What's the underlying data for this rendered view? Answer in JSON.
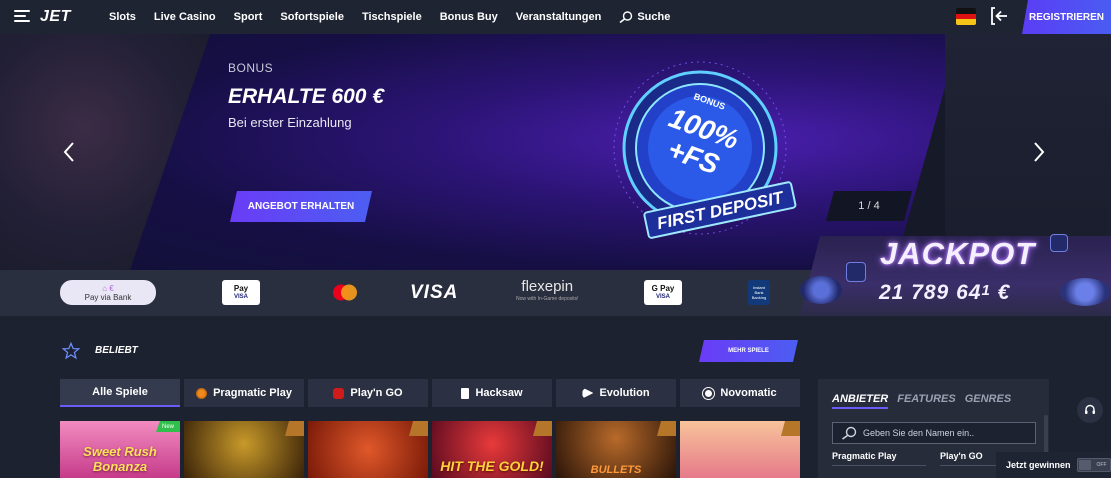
{
  "header": {
    "logo": "JET",
    "nav": [
      "Slots",
      "Live Casino",
      "Sport",
      "Sofortspiele",
      "Tischspiele",
      "Bonus Buy",
      "Veranstaltungen"
    ],
    "search_label": "Suche",
    "register_label": "REGISTRIEREN",
    "language_flag": "de-flag-icon",
    "login_icon": "login-icon"
  },
  "hero": {
    "kicker": "BONUS",
    "title": "ERHALTE 600 €",
    "subtitle": "Bei erster Einzahlung",
    "cta": "ANGEBOT ERHALTEN",
    "pager": "1 / 4",
    "badge": {
      "small": "BONUS",
      "big_line1": "100%",
      "big_line2": "+FS",
      "ring": "FIRST DEPOSIT"
    }
  },
  "payments": {
    "pay_via_bank": "Pay via Bank",
    "apple_pay": "Pay",
    "google_pay": "G Pay",
    "visa": "VISA",
    "flexepin": "flexepin",
    "flexepin_sub": "Now with In-Game deposits!",
    "instant_bank": "Instant Bank Banking",
    "card_label": "VISA"
  },
  "jackpot": {
    "title": "JACKPOT",
    "value": "21 789 64",
    "value_mid": "1",
    "currency": "€"
  },
  "popular": {
    "title": "BELIEBT",
    "more": "MEHR SPIELE"
  },
  "tabs": [
    {
      "label": "Alle Spiele",
      "icon": ""
    },
    {
      "label": "Pragmatic Play",
      "icon": "pragmatic-icon"
    },
    {
      "label": "Play'n GO",
      "icon": "playngo-icon"
    },
    {
      "label": "Hacksaw",
      "icon": "hacksaw-icon"
    },
    {
      "label": "Evolution",
      "icon": "evolution-icon"
    },
    {
      "label": "Novomatic",
      "icon": "novomatic-icon"
    }
  ],
  "games": [
    {
      "title": "Sweet Rush Bonanza",
      "badge": "New",
      "color": "#e9568f"
    },
    {
      "title": "",
      "badge": "",
      "color": "#5a3a14"
    },
    {
      "title": "",
      "badge": "",
      "color": "#b13513"
    },
    {
      "title": "HIT THE GOLD!",
      "badge": "",
      "color": "#8c1d36"
    },
    {
      "title": "BULLETS",
      "badge": "",
      "color": "#4a2614"
    },
    {
      "title": "",
      "badge": "",
      "color": "#f1a77c"
    }
  ],
  "filter": {
    "tabs": [
      "ANBIETER",
      "FEATURES",
      "GENRES"
    ],
    "search_placeholder": "Geben Sie den Namen ein..",
    "providers": [
      "Pragmatic Play",
      "Play'n GO"
    ]
  },
  "footer_widget": {
    "label": "Jetzt gewinnen",
    "toggle": "OFF"
  },
  "colors": {
    "accent": "#5b3df5",
    "background": "#1d2230"
  }
}
